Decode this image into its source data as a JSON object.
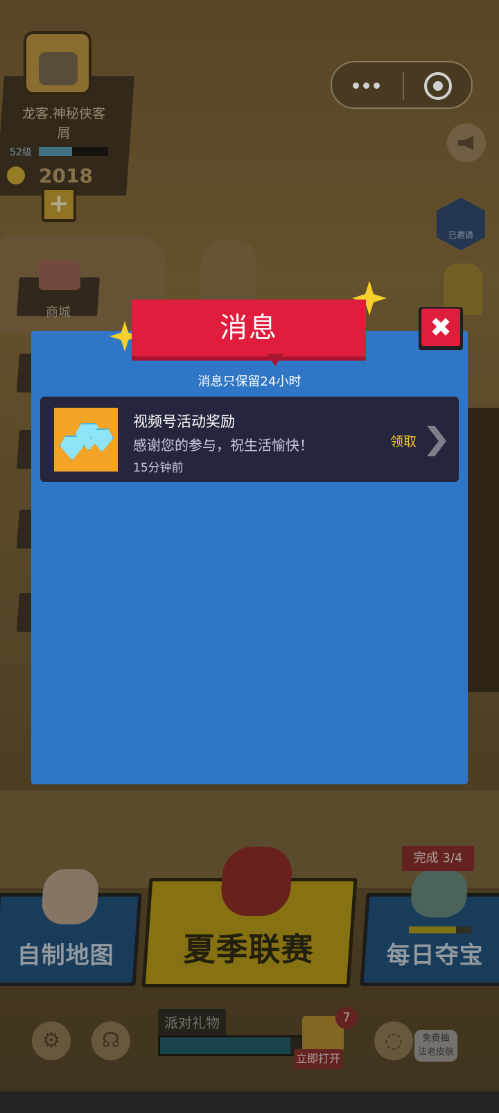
{
  "profile": {
    "name": "龙客.神秘侠客\n屑",
    "level": "52级",
    "level_progress": 0.48,
    "coins": "2018"
  },
  "side_menu": {
    "shop_label": "商城"
  },
  "right_rail": {
    "invited_label": "已邀请"
  },
  "capsule": {
    "more_icon": "more-dots-icon",
    "close_icon": "target-icon"
  },
  "dialog": {
    "title": "消息",
    "subtitle": "消息只保留24小时",
    "close_icon": "close-x-icon",
    "messages": [
      {
        "title": "视频号活动奖励",
        "body": "感谢您的参与，祝生活愉快！",
        "time": "15分钟前",
        "action_label": "领取",
        "thumb_icon": "diamond-gems-icon"
      }
    ]
  },
  "modes": {
    "map_label": "自制地图",
    "summer_label": "夏季联赛",
    "daily_label": "每日夺宝",
    "daily_progress_text": "完成 3/4",
    "daily_progress": 0.75
  },
  "bottom_bar": {
    "gift_label": "派对礼物",
    "gift_progress": 0.92,
    "gift_count": "7",
    "open_now_label": "立即打开",
    "skin_promo": "免费抽\n法老皮肤"
  },
  "colors": {
    "dialog_bg": "#2f76c6",
    "title_red": "#e11d3d",
    "message_bg": "#25253d",
    "claim_gold": "#f0c531"
  }
}
